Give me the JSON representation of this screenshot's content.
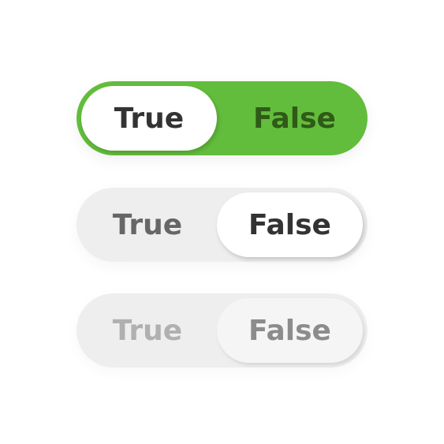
{
  "toggles": [
    {
      "state": "active",
      "selected": "True",
      "true_label": "True",
      "false_label": "False",
      "colors": {
        "track": "#63bd3c",
        "thumb": "#ffffff",
        "selected_text": "#333333",
        "unselected_text": "#2f5a18"
      }
    },
    {
      "state": "inactive",
      "selected": "False",
      "true_label": "True",
      "false_label": "False",
      "colors": {
        "track": "#eeeeee",
        "thumb": "#ffffff",
        "selected_text": "#333333",
        "unselected_text": "#666666"
      }
    },
    {
      "state": "disabled",
      "selected": "False",
      "true_label": "True",
      "false_label": "False",
      "colors": {
        "track": "#eeeeee",
        "thumb": "#f5f5f5",
        "selected_text": "#8c8c8c",
        "unselected_text": "#b0b0b0"
      }
    }
  ]
}
